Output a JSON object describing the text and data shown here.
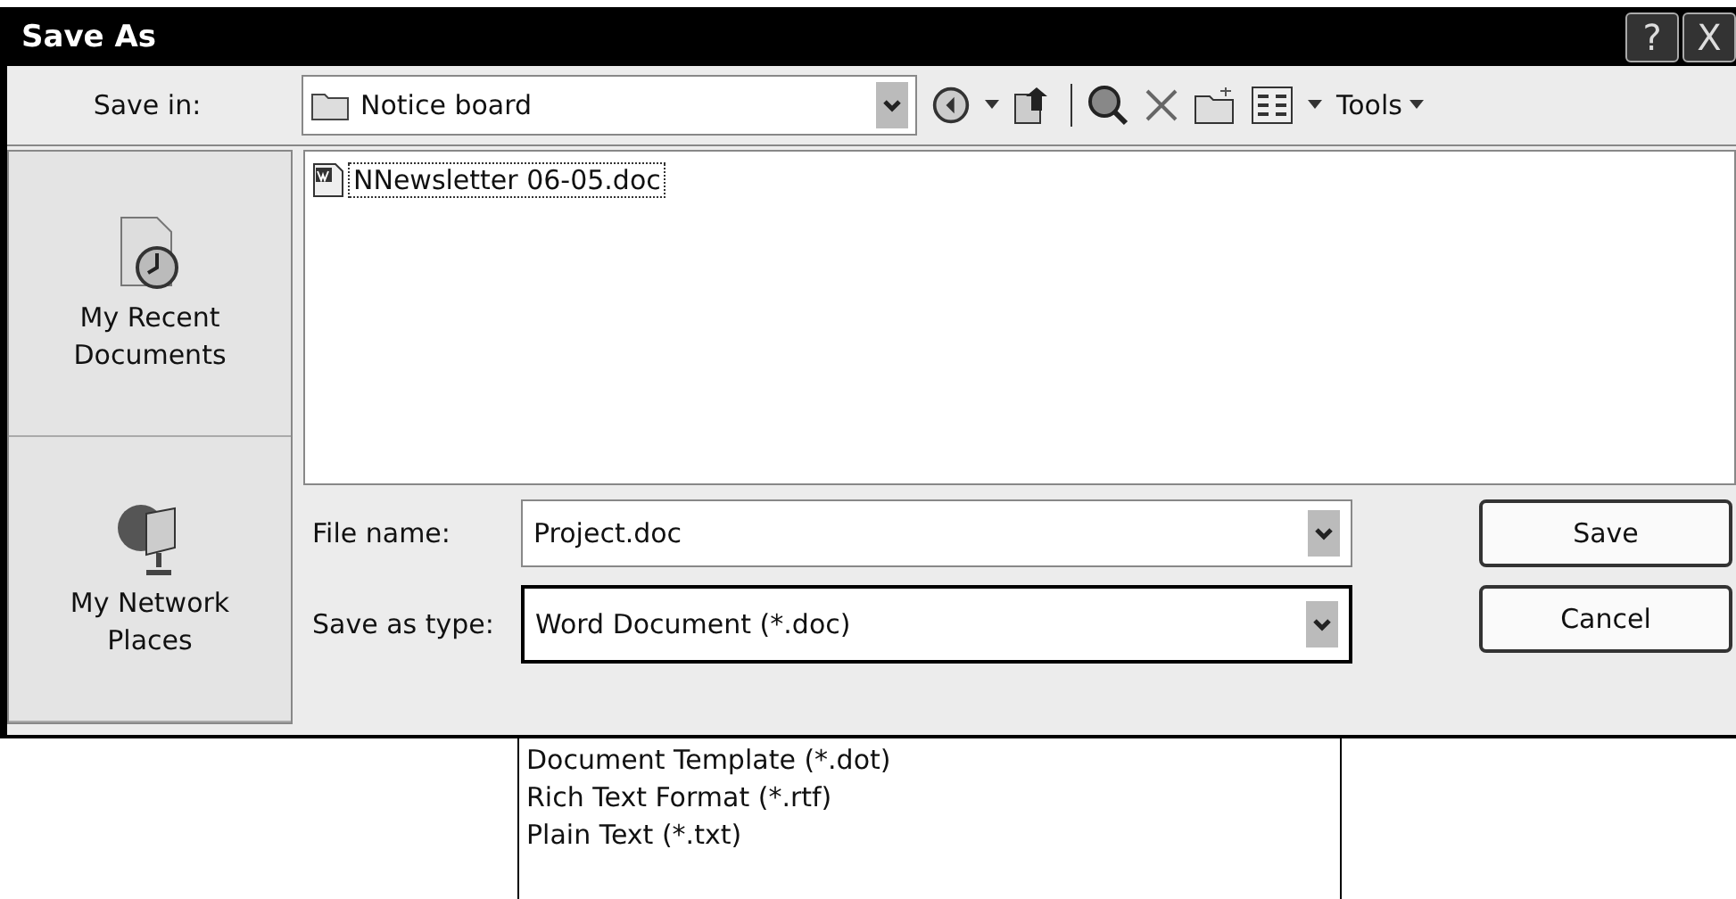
{
  "window": {
    "title": "Save As",
    "title_buttons": [
      "?",
      "X"
    ]
  },
  "save_in": {
    "label": "Save in:",
    "value": "Notice board"
  },
  "toolbar": {
    "tools_label": "Tools"
  },
  "places": [
    {
      "label": "My Recent Documents",
      "kind": "recent"
    },
    {
      "label": "My Network Places",
      "kind": "network"
    }
  ],
  "files": [
    {
      "name": "NNewsletter 06-05.doc",
      "selected": true
    }
  ],
  "file_name": {
    "label": "File name:",
    "value": "Project.doc"
  },
  "save_as_type": {
    "label": "Save as type:",
    "value": "Word Document (*.doc)",
    "expanded": true,
    "options": [
      "Document Template (*.dot)",
      "Rich Text Format (*.rtf)",
      "Plain Text (*.txt)"
    ]
  },
  "buttons": [
    "Save",
    "Cancel"
  ]
}
